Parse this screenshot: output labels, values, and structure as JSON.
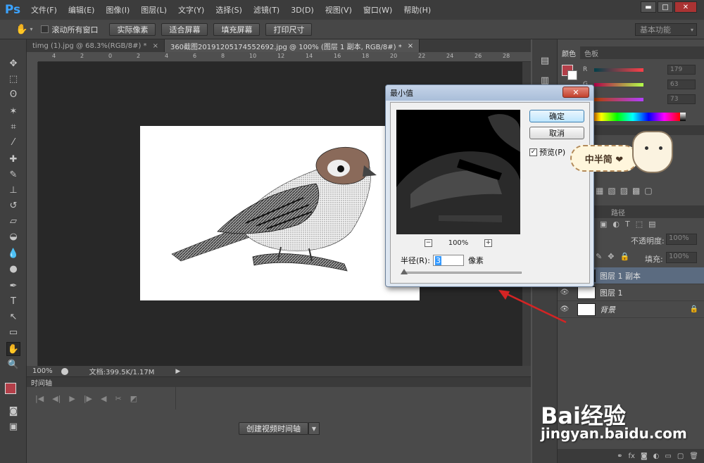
{
  "app": {
    "logo": "Ps"
  },
  "menu": [
    "文件(F)",
    "编辑(E)",
    "图像(I)",
    "图层(L)",
    "文字(Y)",
    "选择(S)",
    "滤镜(T)",
    "3D(D)",
    "视图(V)",
    "窗口(W)",
    "帮助(H)"
  ],
  "window_controls": {
    "minimize": "▬",
    "restore": "□",
    "close": "✕"
  },
  "options_bar": {
    "scroll_all_label": "滚动所有窗口",
    "buttons": [
      "实际像素",
      "适合屏幕",
      "填充屏幕",
      "打印尺寸"
    ],
    "workspace": "基本功能"
  },
  "tabs": [
    {
      "label": "timg (1).jpg @ 68.3%(RGB/8#) *",
      "close": "×"
    },
    {
      "label": "360截图20191205174552692.jpg @ 100% (图层 1 副本, RGB/8#) *",
      "close": "×"
    }
  ],
  "ruler_ticks": [
    "4",
    "2",
    "0",
    "2",
    "4",
    "6",
    "8",
    "10",
    "12",
    "14",
    "16",
    "18",
    "20",
    "22",
    "24",
    "26",
    "28"
  ],
  "status": {
    "zoom": "100%",
    "doc": "文档:399.5K/1.17M"
  },
  "timeline": {
    "title": "时间轴",
    "create_button": "创建视频时间轴"
  },
  "color_panel": {
    "tabs": [
      "颜色",
      "色板"
    ],
    "channels": [
      {
        "label": "R",
        "value": "179"
      },
      {
        "label": "G",
        "value": "63"
      },
      {
        "label": "B",
        "value": "73"
      }
    ],
    "foreground": "#b33f49"
  },
  "layers_panel": {
    "tabs": [
      "路径"
    ],
    "opacity_label": "不透明度:",
    "opacity": "100%",
    "fill_label": "填充:",
    "fill": "100%",
    "layers": [
      {
        "name": "图层 1 副本",
        "selected": true
      },
      {
        "name": "图层 1",
        "selected": false
      },
      {
        "name": "背景",
        "selected": false,
        "locked": true
      }
    ]
  },
  "dialog": {
    "title": "最小值",
    "close": "✕",
    "ok": "确定",
    "cancel": "取消",
    "preview_label": "预览(P)",
    "preview_checked": "✓",
    "zoom": "100%",
    "zoom_out": "−",
    "zoom_in": "+",
    "radius_label": "半径(R):",
    "radius_value": "3",
    "radius_unit": "像素"
  },
  "sticker": {
    "text": "中半简 ❤"
  },
  "watermark": {
    "brand": "Bai经验",
    "url": "jingyan.baidu.com"
  }
}
